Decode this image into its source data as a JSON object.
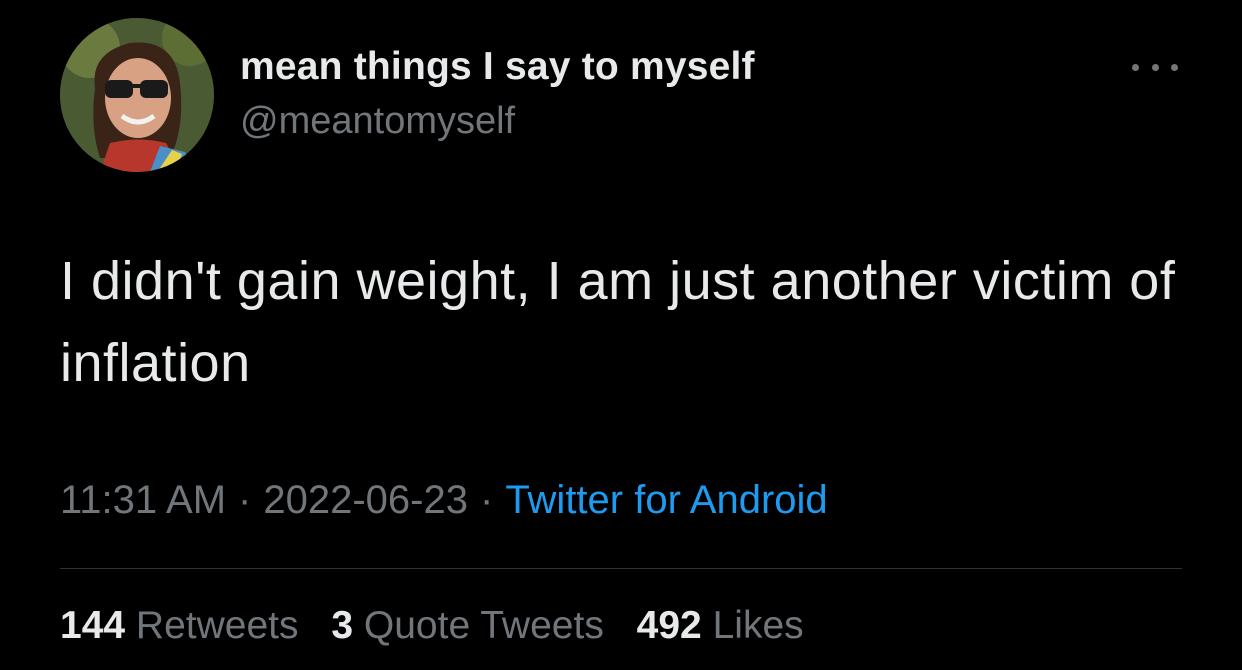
{
  "author": {
    "display_name": "mean things I say to myself",
    "handle": "@meantomyself"
  },
  "tweet": {
    "text": "I didn't gain weight, I am just another victim of inflation",
    "time": "11:31 AM",
    "date": "2022-06-23",
    "separator": "·",
    "source": "Twitter for Android"
  },
  "stats": {
    "retweets_count": "144",
    "retweets_label": "Retweets",
    "quotes_count": "3",
    "quotes_label": "Quote Tweets",
    "likes_count": "492",
    "likes_label": "Likes"
  },
  "icons": {
    "more": "more-horizontal-icon"
  },
  "colors": {
    "background": "#000000",
    "text_primary": "#e7e9ea",
    "text_secondary": "#71767b",
    "accent": "#1d9bf0",
    "divider": "#2f3336"
  }
}
